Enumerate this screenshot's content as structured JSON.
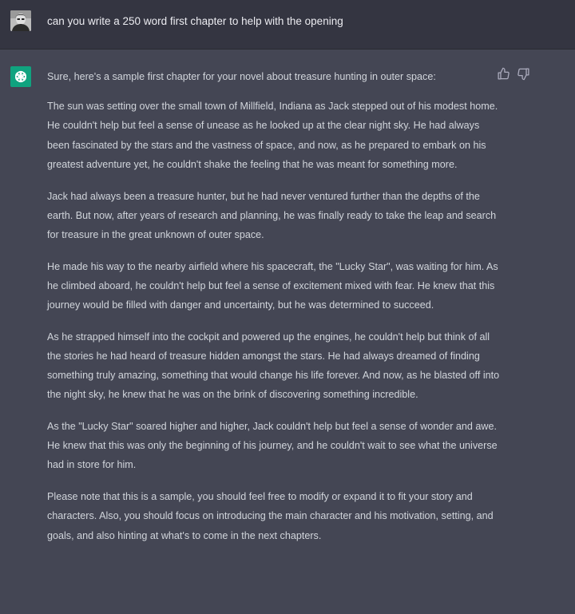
{
  "conversation": {
    "user_message": {
      "avatar": "user-photo-avatar",
      "text": "can you write a 250 word first chapter to help with the opening"
    },
    "assistant_message": {
      "avatar": "openai-logo-icon",
      "avatar_color": "#10a37f",
      "feedback_icons": [
        "thumbs-up-icon",
        "thumbs-down-icon"
      ],
      "paragraphs": [
        "Sure, here's a sample first chapter for your novel about treasure hunting in outer space:",
        "The sun was setting over the small town of Millfield, Indiana as Jack stepped out of his modest home. He couldn't help but feel a sense of unease as he looked up at the clear night sky. He had always been fascinated by the stars and the vastness of space, and now, as he prepared to embark on his greatest adventure yet, he couldn't shake the feeling that he was meant for something more.",
        "Jack had always been a treasure hunter, but he had never ventured further than the depths of the earth. But now, after years of research and planning, he was finally ready to take the leap and search for treasure in the great unknown of outer space.",
        "He made his way to the nearby airfield where his spacecraft, the \"Lucky Star\", was waiting for him. As he climbed aboard, he couldn't help but feel a sense of excitement mixed with fear. He knew that this journey would be filled with danger and uncertainty, but he was determined to succeed.",
        "As he strapped himself into the cockpit and powered up the engines, he couldn't help but think of all the stories he had heard of treasure hidden amongst the stars. He had always dreamed of finding something truly amazing, something that would change his life forever. And now, as he blasted off into the night sky, he knew that he was on the brink of discovering something incredible.",
        "As the \"Lucky Star\" soared higher and higher, Jack couldn't help but feel a sense of wonder and awe. He knew that this was only the beginning of his journey, and he couldn't wait to see what the universe had in store for him.",
        "Please note that this is a sample, you should feel free to modify or expand it to fit your story and characters. Also, you should focus on introducing the main character and his motivation, setting, and goals, and also hinting at what's to come in the next chapters."
      ]
    }
  },
  "colors": {
    "user_background": "#343541",
    "assistant_background": "#444654",
    "text": "#d1d5db",
    "user_text": "#ececf1"
  }
}
